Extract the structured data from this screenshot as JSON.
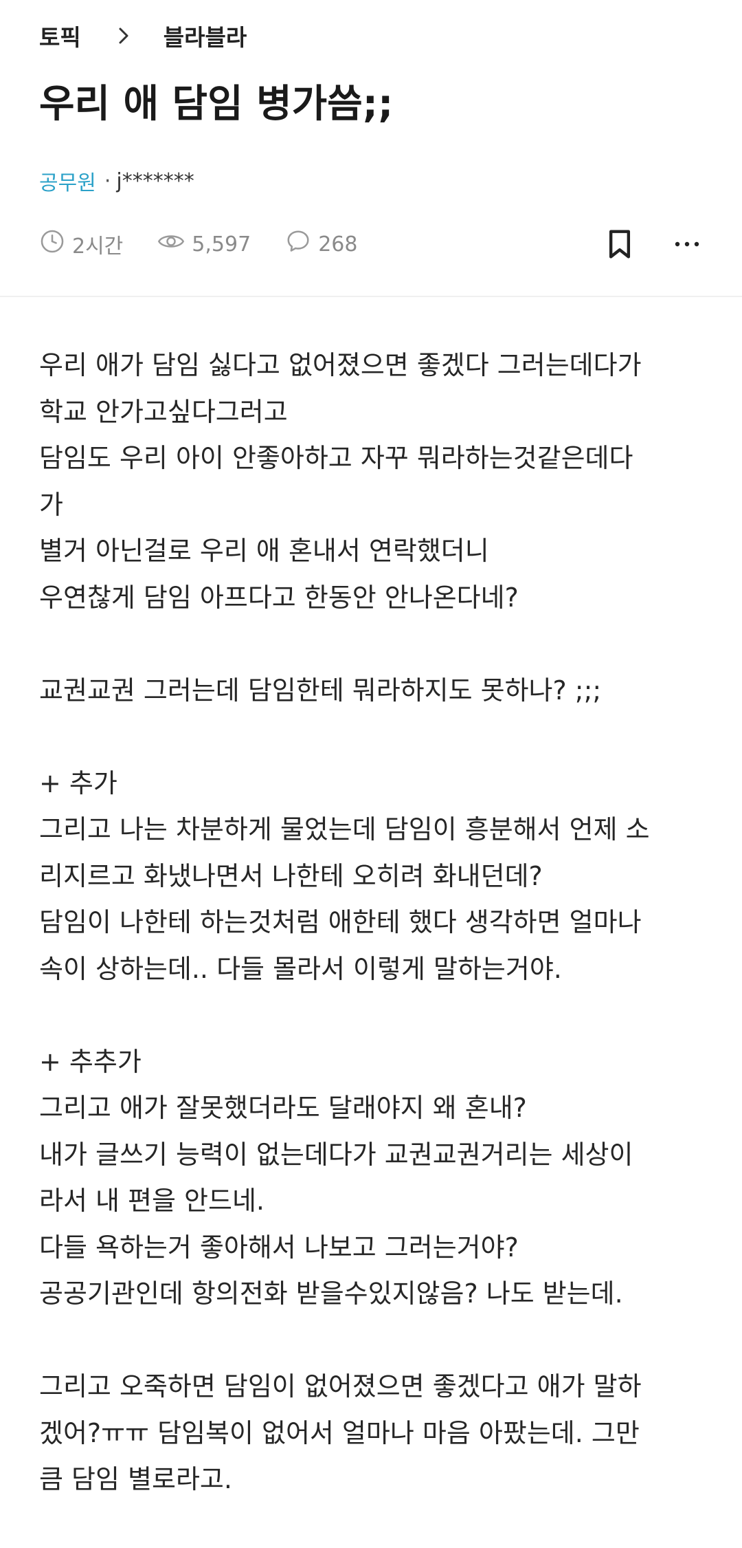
{
  "breadcrumb": {
    "topic": "토픽",
    "board": "블라블라"
  },
  "post": {
    "title": "우리 애 담임 병가씀;;",
    "category": "공무원",
    "separator": "·",
    "author": "j*******",
    "time": "2시간",
    "views": "5,597",
    "comments": "268"
  },
  "icons": {
    "chevron": "chevron-right-icon",
    "time": "clock-icon",
    "views": "eye-icon",
    "comments": "comment-bubble-icon",
    "bookmark": "bookmark-icon",
    "more": "more-horizontal-icon"
  },
  "colors": {
    "category": "#2ba1c8",
    "stats": "#8a8a8a",
    "text": "#262626"
  },
  "body_lines": [
    "우리 애가 담임 싫다고 없어졌으면 좋겠다 그러는데다가",
    "학교 안가고싶다그러고",
    "담임도 우리 아이 안좋아하고 자꾸 뭐라하는것같은데다",
    "가",
    "별거 아닌걸로 우리 애 혼내서 연락했더니",
    "우연찮게 담임 아프다고 한동안 안나온다네?",
    "",
    "교권교권 그러는데 담임한테 뭐라하지도 못하나? ;;;",
    "",
    "+ 추가",
    "그리고 나는 차분하게 물었는데 담임이 흥분해서 언제 소",
    "리지르고 화냈나면서 나한테 오히려 화내던데?",
    "담임이 나한테 하는것처럼 애한테 했다 생각하면 얼마나",
    "속이 상하는데.. 다들 몰라서 이렇게 말하는거야.",
    "",
    "+ 추추가",
    "그리고 애가 잘못했더라도 달래야지 왜 혼내?",
    "내가 글쓰기 능력이 없는데다가 교권교권거리는 세상이",
    "라서 내 편을 안드네.",
    "다들 욕하는거 좋아해서 나보고 그러는거야?",
    "공공기관인데 항의전화 받을수있지않음? 나도 받는데.",
    "",
    "그리고 오죽하면 담임이 없어졌으면 좋겠다고 애가 말하",
    "겠어?ㅠㅠ 담임복이 없어서 얼마나 마음 아팠는데. 그만",
    "큼 담임 별로라고."
  ]
}
